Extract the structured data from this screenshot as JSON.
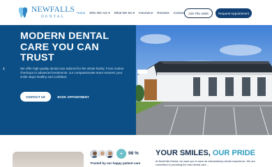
{
  "brand": {
    "name": "NEWFALLS",
    "subtitle": "DENTAL"
  },
  "nav": {
    "items": [
      {
        "label": "Home",
        "active": true
      },
      {
        "label": "Who We Are ▾",
        "active": false
      },
      {
        "label": "What We Do ▾",
        "active": false
      },
      {
        "label": "Insurance",
        "active": false
      },
      {
        "label": "Reviews",
        "active": false
      },
      {
        "label": "Contact Us",
        "active": false
      }
    ],
    "phone": "215-791-1826",
    "appointment": "Request Appointment"
  },
  "hero": {
    "title": "MODERN DENTAL CARE YOU CAN TRUST",
    "copy": "We offer high-quality dental care tailored for the whole family. From routine checkups to advanced treatments, our compassionate team ensures your smile stays healthy and confident.",
    "contact_button": "CONTACT US",
    "book_button": "BOOK APPOINTMENT",
    "prev_arrow": "‹"
  },
  "trust": {
    "percent": "98 %",
    "plus": "+",
    "text": "Trusted by our happy patient care"
  },
  "smiles": {
    "title_main": "YOUR SMILES, ",
    "title_accent": "OUR PRIDE",
    "copy": "At NewFalls Dental, we want you to have an extraordinary dental experience. We are committed to providing the best dental care..."
  },
  "colors": {
    "brand_blue": "#2f84c3",
    "hero_blue": "#0b4f86",
    "navy": "#16304f",
    "teal": "#2f9ec0"
  }
}
